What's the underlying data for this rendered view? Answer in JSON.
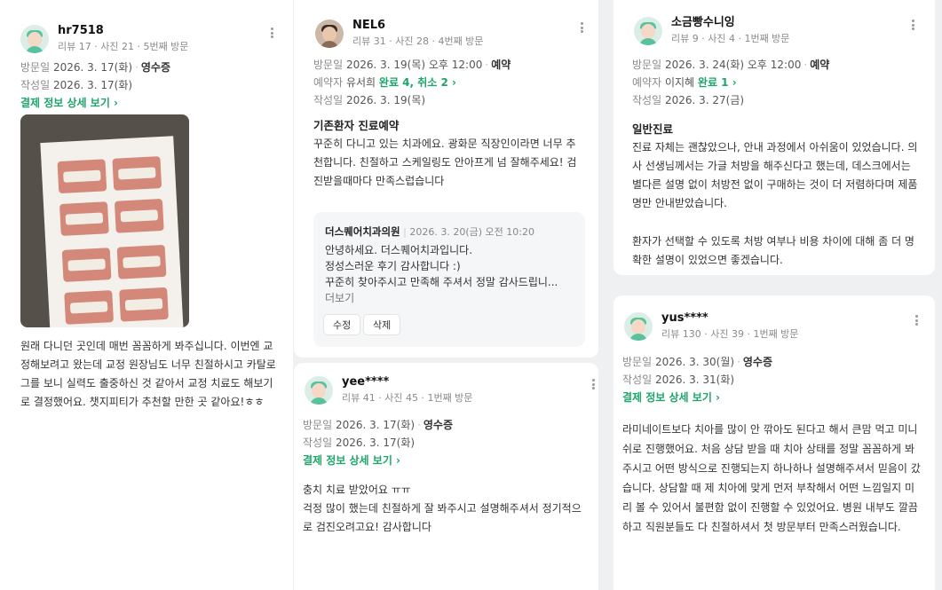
{
  "reviews": [
    {
      "username": "hr7518",
      "stats": "리뷰 17 · 사진 21 · 5번째 방문",
      "visit_label": "방문일",
      "visit_date": "2026. 3. 17(화)",
      "visit_tag": "영수증",
      "write_label": "작성일",
      "write_date": "2026. 3. 17(화)",
      "payment_link": "결제 정보 상세 보기 ›",
      "body": "원래 다니던 곳인데 매번 꼼꼼하게 봐주십니다. 이번엔 교정해보려고 왔는데 교정 원장님도 너무 친절하시고 카탈로그를 보니 실력도 출중하신 것 같아서 교정 치료도 해보기로 결정했어요. 챗지피티가 추천할 만한 곳 같아요!ㅎㅎ"
    },
    {
      "username": "NEL6",
      "stats": "리뷰 31 · 사진 28 · 4번째 방문",
      "visit_label": "방문일",
      "visit_date": "2026. 3. 19(목) 오후 12:00",
      "visit_tag": "예약",
      "booker_label": "예약자",
      "booker_name": "유서희",
      "booker_status": "완료 4, 취소 2 ›",
      "write_label": "작성일",
      "write_date": "2026. 3. 19(목)",
      "title": "기존환자 진료예약",
      "body": "꾸준히 다니고 있는 치과에요. 광화문 직장인이라면 너무 추천합니다. 친절하고 스케일링도 안아프게 넘 잘해주세요! 검진받을때마다 만족스럽습니다",
      "reply": {
        "clinic": "더스퀘어치과의원",
        "date": "2026. 3. 20(금) 오전 10:20",
        "line1": "안녕하세요. 더스퀘어치과입니다.",
        "line2": "정성스러운 후기 감사합니다 :)",
        "line3": "꾸준히 찾아주시고 만족해 주셔서 정말 감사드립니...",
        "more": "더보기",
        "edit": "수정",
        "delete": "삭제"
      }
    },
    {
      "username": "yee****",
      "stats": "리뷰 41 · 사진 45 · 1번째 방문",
      "visit_label": "방문일",
      "visit_date": "2026. 3. 17(화)",
      "visit_tag": "영수증",
      "write_label": "작성일",
      "write_date": "2026. 3. 17(화)",
      "payment_link": "결제 정보 상세 보기 ›",
      "body": "충치 치료 받았어요 ㅠㅠ\n걱정 많이 했는데 친절하게 잘 봐주시고 설명해주셔서 정기적으로 검진오려고요! 감사합니다"
    },
    {
      "username": "소금빵수니잉",
      "stats": "리뷰 9 · 사진 4 · 1번째 방문",
      "visit_label": "방문일",
      "visit_date": "2026. 3. 24(화) 오후 12:00",
      "visit_tag": "예약",
      "booker_label": "예약자",
      "booker_name": "이지혜",
      "booker_status": "완료 1 ›",
      "write_label": "작성일",
      "write_date": "2026. 3. 27(금)",
      "title": "일반진료",
      "body": "진료 자체는 괜찮았으나, 안내 과정에서 아쉬움이 있었습니다. 의사 선생님께서는 가글 처방을 해주신다고 했는데, 데스크에서는 별다른 설명 없이 처방전 없이 구매하는 것이 더 저렴하다며 제품명만 안내받았습니다.",
      "body2": "환자가 선택할 수 있도록 처방 여부나 비용 차이에 대해 좀 더 명확한 설명이 있었으면 좋겠습니다."
    },
    {
      "username": "yus****",
      "stats": "리뷰 130 · 사진 39 · 1번째 방문",
      "visit_label": "방문일",
      "visit_date": "2026. 3. 30(월)",
      "visit_tag": "영수증",
      "write_label": "작성일",
      "write_date": "2026. 3. 31(화)",
      "payment_link": "결제 정보 상세 보기 ›",
      "body": "라미네이트보다 치아를 많이 안 깎아도 된다고 해서 큰맘 먹고 미니쉬로 진행했어요. 처음 상담 받을 때 치아 상태를 정말 꼼꼼하게 봐주시고 어떤 방식으로 진행되는지 하나하나 설명해주셔서 믿음이 갔습니다. 상담할 때 제 치아에 맞게 먼저 부착해서 어떤 느낌일지 미리 볼 수 있어서 불편함 없이 진행할 수 있었어요. 병원 내부도 깔끔하고 직원분들도 다 친절하셔서 첫 방문부터 만족스러웠습니다."
    }
  ]
}
